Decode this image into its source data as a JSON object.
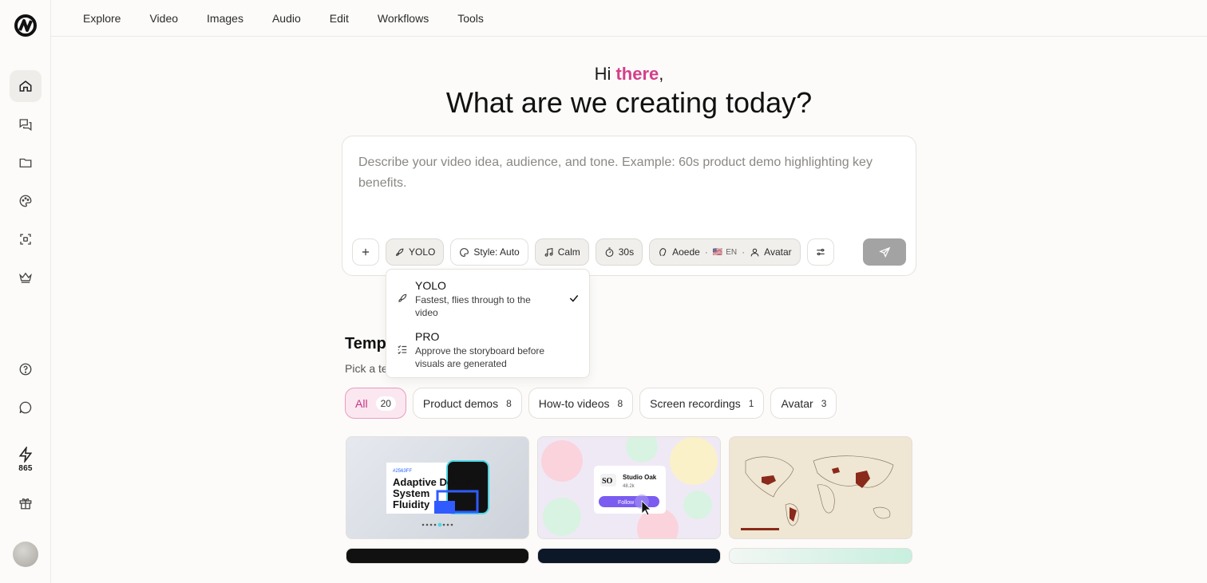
{
  "nav": {
    "items": [
      "Explore",
      "Video",
      "Images",
      "Audio",
      "Edit",
      "Workflows",
      "Tools"
    ]
  },
  "sidebar": {
    "credits": "865"
  },
  "greeting": {
    "hi": "Hi",
    "name": "there",
    "comma": ",",
    "headline": "What are we creating today?"
  },
  "composer": {
    "placeholder": "Describe your video idea, audience, and tone. Example: 60s product demo highlighting key benefits.",
    "mode_label": "YOLO",
    "style_label": "Style: Auto",
    "music_label": "Calm",
    "duration_label": "30s",
    "voice_label": "Aoede",
    "lang_flag": "🇺🇸",
    "lang_label": "EN",
    "avatar_label": "Avatar"
  },
  "mode_menu": {
    "options": [
      {
        "title": "YOLO",
        "desc": "Fastest, flies through to the video",
        "selected": true
      },
      {
        "title": "PRO",
        "desc": "Approve the storyboard before visuals are generated",
        "selected": false
      }
    ]
  },
  "templates": {
    "title": "Temp",
    "subtitle": "Pick a te",
    "filters": [
      {
        "label": "All",
        "count": "20",
        "active": true
      },
      {
        "label": "Product demos",
        "count": "8",
        "active": false
      },
      {
        "label": "How-to videos",
        "count": "8",
        "active": false
      },
      {
        "label": "Screen recordings",
        "count": "1",
        "active": false
      },
      {
        "label": "Avatar",
        "count": "3",
        "active": false
      }
    ],
    "cards": [
      {
        "lines": [
          "#2563FF",
          "Adaptive Design",
          "System",
          "Fluidity"
        ]
      },
      {
        "lines": [
          "SO",
          "Studio Oak",
          "48.2k",
          "Follow"
        ]
      },
      {
        "lines": []
      }
    ]
  },
  "colors": {
    "accent_pink": "#d43f8a",
    "send_disabled": "#a3a3a3"
  }
}
